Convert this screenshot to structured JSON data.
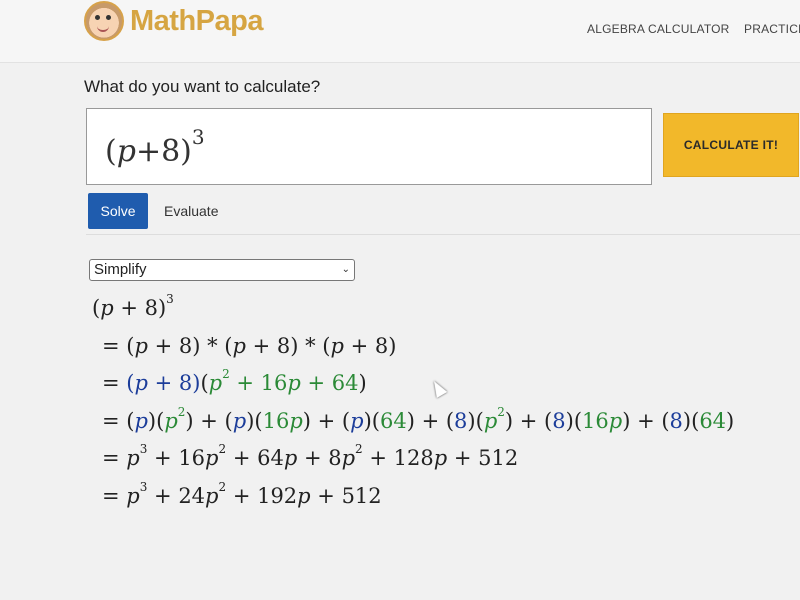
{
  "header": {
    "logo_text": "MathPapa",
    "nav": [
      "ALGEBRA CALCULATOR",
      "PRACTICE"
    ]
  },
  "calculator": {
    "question": "What do you want to calculate?",
    "input_value": "(p+8)^3",
    "input_display": {
      "base": "(",
      "var": "p",
      "rest": "+8)",
      "exp": "3"
    },
    "calculate_label": "CALCULATE IT!",
    "tabs": [
      {
        "label": "Solve",
        "active": true
      },
      {
        "label": "Evaluate",
        "active": false
      }
    ],
    "mode_select": "Simplify"
  },
  "solution": {
    "steps": [
      "(p + 8)^3",
      "= (p + 8) * (p + 8) * (p + 8)",
      "= (p + 8)(p^2 + 16p + 64)",
      "= (p)(p^2) + (p)(16p) + (p)(64) + (8)(p^2) + (8)(16p) + (8)(64)",
      "= p^3 + 16p^2 + 64p + 8p^2 + 128p + 512",
      "= p^3 + 24p^2 + 192p + 512"
    ]
  },
  "colors": {
    "brand": "#d6a542",
    "button": "#f2b82a",
    "solve_tab": "#1f5cae",
    "term_blue": "#1c3d9a",
    "term_green": "#2b8a37"
  }
}
